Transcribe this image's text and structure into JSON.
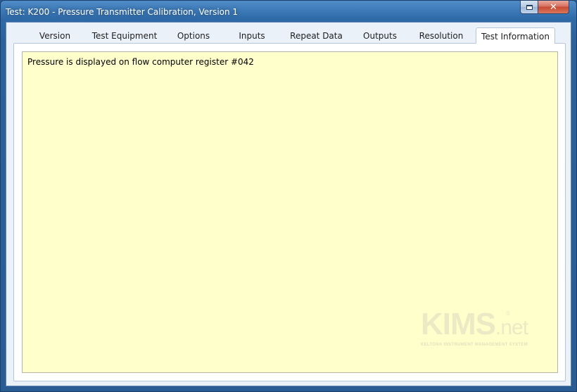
{
  "window": {
    "title": "Test: K200 - Pressure Transmitter Calibration, Version 1",
    "close_glyph": "✕",
    "maximize_icon": "maximize-icon",
    "close_icon": "close-icon"
  },
  "tabs": [
    {
      "label": "Version"
    },
    {
      "label": "Test Equipment"
    },
    {
      "label": "Options"
    },
    {
      "label": "Inputs"
    },
    {
      "label": "Repeat Data"
    },
    {
      "label": "Outputs"
    },
    {
      "label": "Resolution"
    },
    {
      "label": "Test Information",
      "active": true
    }
  ],
  "test_information": {
    "text": "Pressure is displayed on flow computer register #042"
  },
  "watermark": {
    "brand": "KIMS",
    "suffix": ".net",
    "registered": "®",
    "tagline": "KELTON® INSTRUMENT MANAGEMENT SYSTEM"
  },
  "colors": {
    "title_bar": "#2f6aa8",
    "client_background": "#ebf1f9",
    "info_background": "#ffffcc",
    "close_button": "#c74a33"
  }
}
